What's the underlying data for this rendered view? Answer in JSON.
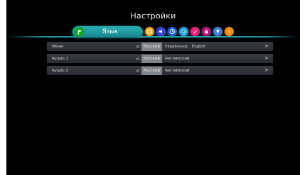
{
  "header": {
    "title": "Настройки"
  },
  "active_tab": {
    "label": "Язык",
    "icon": "flag-icon"
  },
  "category_icons": [
    {
      "name": "picture-icon",
      "color": "#f2a51f"
    },
    {
      "name": "audio-icon",
      "color": "#3c3fd6"
    },
    {
      "name": "clock-icon",
      "color": "#1d5fe0"
    },
    {
      "name": "globe-icon",
      "color": "#2e9fe8"
    },
    {
      "name": "edit-icon",
      "color": "#e8217a"
    },
    {
      "name": "lock-icon",
      "color": "#b3127a"
    },
    {
      "name": "antenna-icon",
      "color": "#3f7fd6"
    },
    {
      "name": "info-icon",
      "color": "#ee8a18"
    }
  ],
  "rows": [
    {
      "label": "Меню",
      "options": [
        "Русский",
        "Українська",
        "English"
      ],
      "selected": 0
    },
    {
      "label": "Аудио 1",
      "options": [
        "Русский",
        "Английский"
      ],
      "selected": 0
    },
    {
      "label": "Аудио 2",
      "options": [
        "Русский",
        "Английский"
      ],
      "selected": 0
    }
  ],
  "arrows": {
    "left": "<",
    "right": ">"
  }
}
